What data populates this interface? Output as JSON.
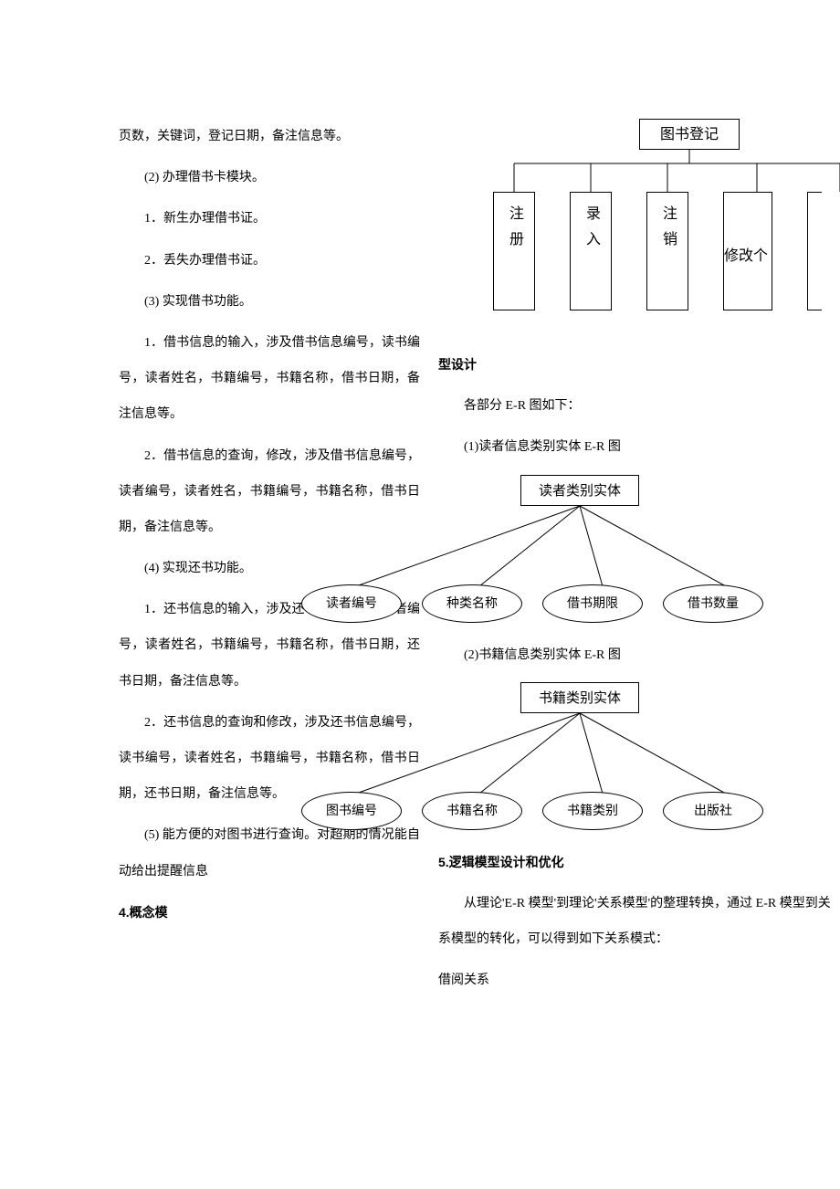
{
  "left": {
    "p1": "页数，关键词，登记日期，备注信息等。",
    "p2": "(2) 办理借书卡模块。",
    "p3": "1．新生办理借书证。",
    "p4": "2．丢失办理借书证。",
    "p5": "(3) 实现借书功能。",
    "p6": "1．借书信息的输入，涉及借书信息编号，读书编号，读者姓名，书籍编号，书籍名称，借书日期，备注信息等。",
    "p7": "2．借书信息的查询，修改，涉及借书信息编号，读者编号，读者姓名，书籍编号，书籍名称，借书日期，备注信息等。",
    "p8": "(4) 实现还书功能。",
    "p9": "1．还书信息的输入，涉及还书信息编号，读者编号，读者姓名，书籍编号，书籍名称，借书日期，还书日期，备注信息等。",
    "p10": "2．还书信息的查询和修改，涉及还书信息编号，读书编号，读者姓名，书籍编号，书籍名称，借书日期，还书日期，备注信息等。",
    "p11": "(5) 能方便的对图书进行查询。对超期的情况能自动给出提醒信息",
    "p12": "4.概念模"
  },
  "right": {
    "p1": "型设计",
    "p2": "各部分 E-R 图如下：",
    "p3": "(1)读者信息类别实体 E-R 图",
    "p4": "(2)书籍信息类别实体 E-R 图",
    "p5": "5.逻辑模型设计和优化",
    "p6": "从理论'E-R 模型'到理论'关系模型'的整理转换，通过 E-R 模型到关系模型的转化，可以得到如下关系模式：",
    "p7": "借阅关系"
  },
  "org": {
    "root": "图书登记",
    "children": [
      "注册",
      "录入",
      "注销",
      "修改个"
    ]
  },
  "er1": {
    "entity": "读者类别实体",
    "attrs": [
      "读者编号",
      "种类名称",
      "借书期限",
      "借书数量"
    ]
  },
  "er2": {
    "entity": "书籍类别实体",
    "attrs": [
      "图书编号",
      "书籍名称",
      "书籍类别",
      "出版社"
    ]
  },
  "chart_data": [
    {
      "type": "tree",
      "title": "图书登记",
      "root": "图书登记",
      "children": [
        "注册",
        "录入",
        "注销",
        "修改个"
      ]
    },
    {
      "type": "er",
      "entity": "读者类别实体",
      "attributes": [
        "读者编号",
        "种类名称",
        "借书期限",
        "借书数量"
      ]
    },
    {
      "type": "er",
      "entity": "书籍类别实体",
      "attributes": [
        "图书编号",
        "书籍名称",
        "书籍类别",
        "出版社"
      ]
    }
  ]
}
